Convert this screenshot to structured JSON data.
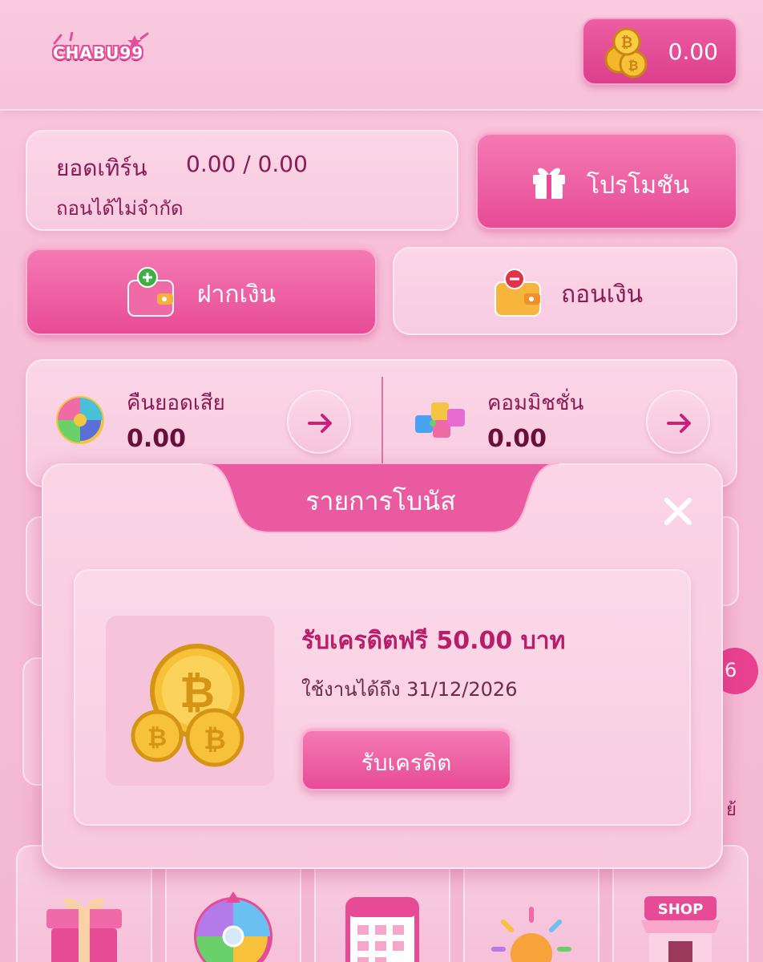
{
  "header": {
    "logo_text": "CHABU99",
    "balance": "0.00"
  },
  "turnover": {
    "label": "ยอดเทิร์น",
    "value": "0.00 / 0.00",
    "withdraw_limit": "ถอนได้ไม่จำกัด"
  },
  "actions": {
    "promotion_label": "โปรโมชัน",
    "deposit_label": "ฝากเงิน",
    "withdraw_label": "ถอนเงิน"
  },
  "stats": {
    "cashback_label": "คืนยอดเสีย",
    "cashback_value": "0.00",
    "commission_label": "คอมมิชชั่น",
    "commission_value": "0.00"
  },
  "background_peek": {
    "badge_text": "6",
    "side_text": "ย้"
  },
  "modal": {
    "title": "รายการโบนัส",
    "bonus": {
      "title": "รับเครดิตฟรี 50.00 บาท",
      "expiry": "ใช้งานได้ถึง 31/12/2026",
      "claim_label": "รับเครดิต"
    }
  },
  "bottom_icons": [
    {
      "icon": "gift-box-icon"
    },
    {
      "icon": "lucky-wheel-icon"
    },
    {
      "icon": "calendar-icon"
    },
    {
      "icon": "sunrise-icon"
    },
    {
      "icon": "shop-icon",
      "label": "SHOP"
    }
  ],
  "colors": {
    "accent": "#e84b96",
    "accent_dark": "#b81d6a",
    "background": "#f9c6de",
    "text": "#8b1a55"
  }
}
